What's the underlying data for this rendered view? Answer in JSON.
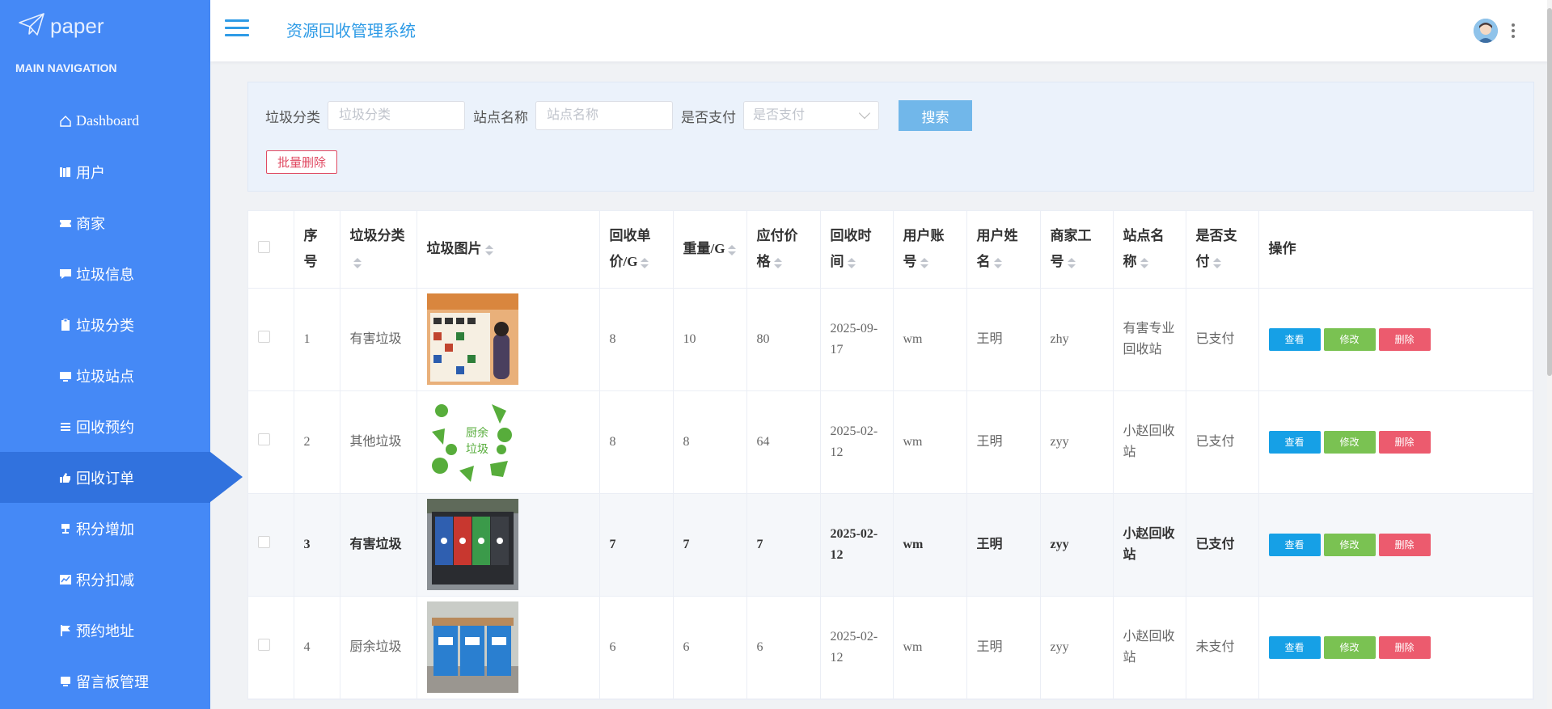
{
  "logo": {
    "text": "paper"
  },
  "sidebar": {
    "heading": "MAIN NAVIGATION",
    "items": [
      {
        "label": "Dashboard",
        "icon": "home-icon"
      },
      {
        "label": "用户",
        "icon": "books-icon"
      },
      {
        "label": "商家",
        "icon": "ticket-icon"
      },
      {
        "label": "垃圾信息",
        "icon": "comment-icon"
      },
      {
        "label": "垃圾分类",
        "icon": "clipboard-icon"
      },
      {
        "label": "垃圾站点",
        "icon": "monitor-icon"
      },
      {
        "label": "回收预约",
        "icon": "list-icon"
      },
      {
        "label": "回收订单",
        "icon": "thumbs-up-icon",
        "active": true
      },
      {
        "label": "积分增加",
        "icon": "trophy-icon"
      },
      {
        "label": "积分扣减",
        "icon": "chart-icon"
      },
      {
        "label": "预约地址",
        "icon": "flag-icon"
      },
      {
        "label": "留言板管理",
        "icon": "message-icon"
      }
    ]
  },
  "header": {
    "title": "资源回收管理系统"
  },
  "search": {
    "category_label": "垃圾分类",
    "category_placeholder": "垃圾分类",
    "station_label": "站点名称",
    "station_placeholder": "站点名称",
    "paid_label": "是否支付",
    "paid_placeholder": "是否支付",
    "search_button": "搜索",
    "batch_delete_button": "批量删除"
  },
  "table": {
    "columns": [
      "序号",
      "垃圾分类",
      "垃圾图片",
      "回收单价/G",
      "重量/G",
      "应付价格",
      "回收时间",
      "用户账号",
      "用户姓名",
      "商家工号",
      "站点名称",
      "是否支付",
      "操作"
    ],
    "actions": {
      "view": "查看",
      "edit": "修改",
      "delete": "删除"
    },
    "rows": [
      {
        "index": "1",
        "category": "有害垃圾",
        "price": "8",
        "weight": "10",
        "payable": "80",
        "time": "2025-09-17",
        "account": "wm",
        "name": "王明",
        "merchant": "zhy",
        "station": "有害专业回收站",
        "paid": "已支付"
      },
      {
        "index": "2",
        "category": "其他垃圾",
        "price": "8",
        "weight": "8",
        "payable": "64",
        "time": "2025-02-12",
        "account": "wm",
        "name": "王明",
        "merchant": "zyy",
        "station": "小赵回收站",
        "paid": "已支付"
      },
      {
        "index": "3",
        "category": "有害垃圾",
        "price": "7",
        "weight": "7",
        "payable": "7",
        "time": "2025-02-12",
        "account": "wm",
        "name": "王明",
        "merchant": "zyy",
        "station": "小赵回收站",
        "paid": "已支付"
      },
      {
        "index": "4",
        "category": "厨余垃圾",
        "price": "6",
        "weight": "6",
        "payable": "6",
        "time": "2025-02-12",
        "account": "wm",
        "name": "王明",
        "merchant": "zyy",
        "station": "小赵回收站",
        "paid": "未支付"
      }
    ]
  },
  "colors": {
    "sidebar": "#4589f6",
    "sidebar_active": "#3172de",
    "title": "#2e9be6",
    "view": "#16a0e6",
    "edit": "#7ac252",
    "delete": "#ec5b6e"
  }
}
